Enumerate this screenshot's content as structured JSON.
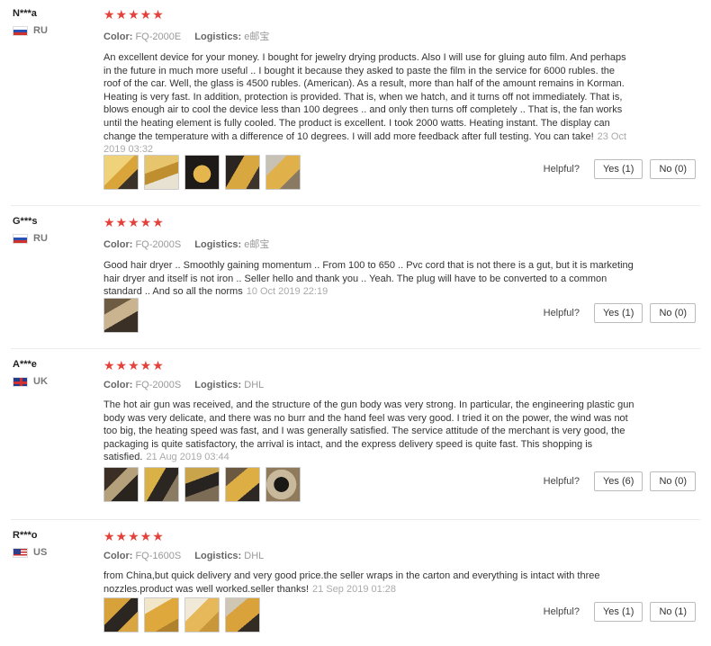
{
  "labels": {
    "color": "Color:",
    "logistics": "Logistics:",
    "helpful": "Helpful?"
  },
  "colors": {
    "stars": "#e5413b",
    "divider": "#ececec",
    "thumb_dark": "#2b2620",
    "thumb_yellow": "#e2b53d"
  },
  "reviews": [
    {
      "user": "N***a",
      "country": "RU",
      "flag_icon": "russia-flag-icon",
      "stars": "★★★★★",
      "color": "FQ-2000E",
      "logistics": "e邮宝",
      "text": "An excellent device for your money. I bought for jewelry drying products. Also I will use for gluing auto film. And perhaps in the future in much more useful .. I bought it because they asked to paste the film in the service for 6000 rubles. the roof of the car. Well, the glass is 4500 rubles. (American). As a result, more than half of the amount remains in Korman. Heating is very fast. In addition, protection is provided. That is, when we hatch, and it turns off not immediately. That is, blows enough air to cool the device less than 100 degrees .. and only then turns off completely .. That is, the fan works until the heating element is fully cooled. The product is excellent. I took 2000 watts. Heating instant. The display can change the temperature with a difference of 10 degrees. I will add more feedback after full testing. You can take!",
      "date": "23 Oct 2019 03:32",
      "yes": "Yes (1)",
      "no": "No (0)"
    },
    {
      "user": "G***s",
      "country": "RU",
      "flag_icon": "russia-flag-icon",
      "stars": "★★★★★",
      "color": "FQ-2000S",
      "logistics": "e邮宝",
      "text": "Good hair dryer .. Smoothly gaining momentum .. From 100 to 650 .. Pvc cord that is not there is a gut, but it is marketing hair dryer and itself is not iron .. Seller hello and thank you .. Yeah. The plug will have to be converted to a common standard .. And so all the norms",
      "date": "10 Oct 2019 22:19",
      "yes": "Yes (1)",
      "no": "No (0)"
    },
    {
      "user": "A***e",
      "country": "UK",
      "flag_icon": "uk-flag-icon",
      "stars": "★★★★★",
      "color": "FQ-2000S",
      "logistics": "DHL",
      "text": "The hot air gun was received, and the structure of the gun body was very strong. In particular, the engineering plastic gun body was very delicate, and there was no burr and the hand feel was very good. I tried it on the power, the wind was not too big, the heating speed was fast, and I was generally satisfied. The service attitude of the merchant is very good, the packaging is quite satisfactory, the arrival is intact, and the express delivery speed is quite fast. This shopping is satisfied.",
      "date": "21 Aug 2019 03:44",
      "yes": "Yes (6)",
      "no": "No (0)"
    },
    {
      "user": "R***o",
      "country": "US",
      "flag_icon": "us-flag-icon",
      "stars": "★★★★★",
      "color": "FQ-1600S",
      "logistics": "DHL",
      "text": "from China,but quick delivery and very good price.the seller wraps in the carton and everything is intact with three nozzles.product was well worked.seller thanks!",
      "date": "21 Sep 2019 01:28",
      "yes": "Yes (1)",
      "no": "No (1)"
    }
  ]
}
